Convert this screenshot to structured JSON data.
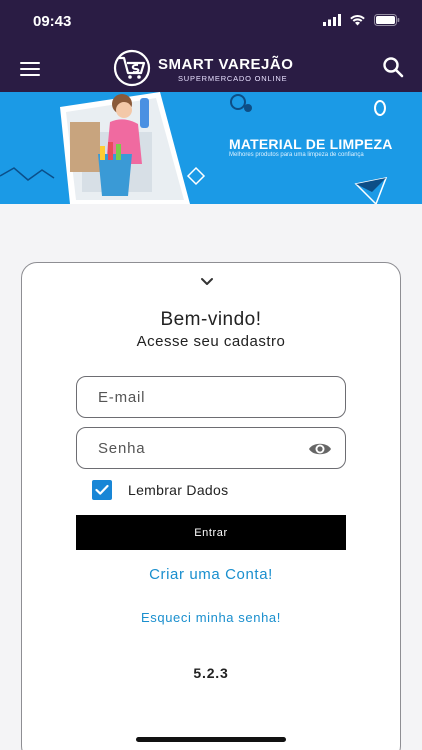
{
  "status_bar": {
    "time": "09:43"
  },
  "header": {
    "logo_title": "SMART VAREJÃO",
    "logo_subtitle": "SUPERMERCADO ONLINE",
    "menu_icon": "hamburger-icon",
    "search_icon": "search-icon"
  },
  "banner": {
    "title": "MATERIAL DE LIMPEZA",
    "subtitle": "Melhores produtos para uma limpeza de confiança"
  },
  "login": {
    "welcome": "Bem-vindo!",
    "subtitle": "Acesse seu cadastro",
    "email_placeholder": "E-mail",
    "password_placeholder": "Senha",
    "remember_label": "Lembrar Dados",
    "remember_checked": true,
    "enter_button": "Entrar",
    "create_account": "Criar uma Conta!",
    "forgot_password": "Esqueci minha senha!",
    "version": "5.2.3"
  },
  "colors": {
    "header_bg": "#2a1c44",
    "banner_bg": "#1b9ae6",
    "link": "#1a8fce",
    "checkbox": "#1886d6",
    "button_bg": "#000000"
  }
}
